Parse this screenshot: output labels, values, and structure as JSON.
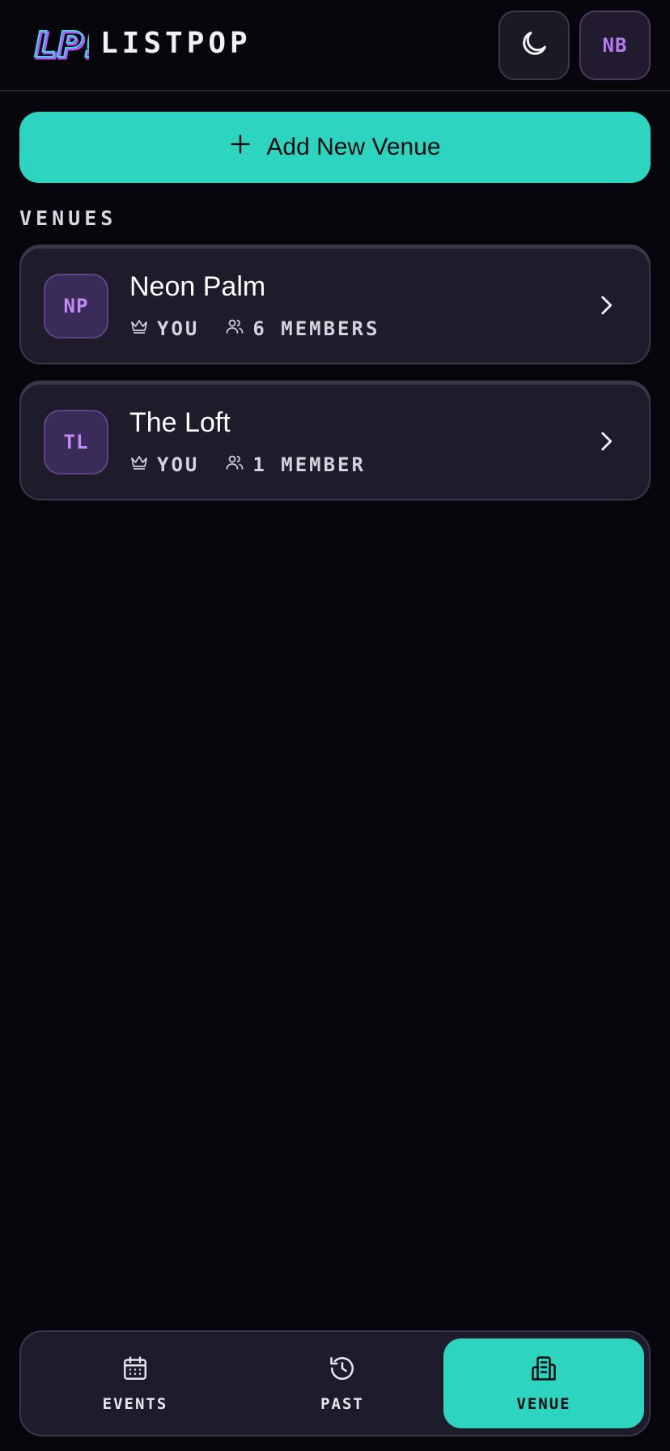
{
  "header": {
    "logo_text": "LP!",
    "brand": "LISTPOP",
    "theme_icon": "moon-icon",
    "avatar_initials": "NB"
  },
  "actions": {
    "add_venue_label": "Add New Venue",
    "add_icon": "plus-icon"
  },
  "venues_section": {
    "label": "VENUES",
    "items": [
      {
        "initials": "NP",
        "name": "Neon Palm",
        "owner": "YOU",
        "members": "6 MEMBERS"
      },
      {
        "initials": "TL",
        "name": "The Loft",
        "owner": "YOU",
        "members": "1 MEMBER"
      }
    ]
  },
  "bottom_nav": {
    "items": [
      {
        "label": "EVENTS",
        "icon": "calendar-icon",
        "active": false
      },
      {
        "label": "PAST",
        "icon": "history-icon",
        "active": false
      },
      {
        "label": "VENUE",
        "icon": "building-icon",
        "active": true
      }
    ]
  },
  "colors": {
    "background": "#07060c",
    "accent": "#2dd4bf",
    "card": "#1e1b2b",
    "badge_text": "#c58bf5"
  }
}
